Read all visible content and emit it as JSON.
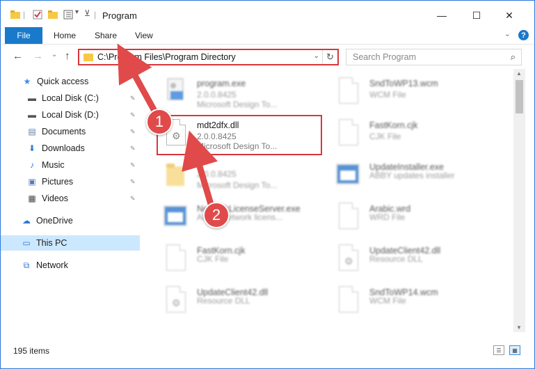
{
  "window": {
    "title": "Program",
    "minimize_glyph": "—",
    "maximize_glyph": "☐",
    "close_glyph": "✕"
  },
  "ribbon": {
    "tabs": [
      {
        "label": "File",
        "active": true
      },
      {
        "label": "Home"
      },
      {
        "label": "Share"
      },
      {
        "label": "View"
      }
    ],
    "help_glyph": "?",
    "expand_glyph": "⌄"
  },
  "nav": {
    "back_glyph": "←",
    "forward_glyph": "→",
    "recent_glyph": "⌄",
    "up_glyph": "↑"
  },
  "address": {
    "path": "C:\\Program Files\\Program Directory",
    "dropdown_glyph": "⌄",
    "refresh_glyph": "↻"
  },
  "search": {
    "placeholder": "Search Program",
    "icon_glyph": "⌕"
  },
  "sidebar": {
    "items": [
      {
        "label": "Quick access",
        "icon": "star-icon",
        "glyph": "★",
        "color": "#3c8de0",
        "pinned": false
      },
      {
        "label": "Local Disk (C:)",
        "icon": "drive-icon",
        "glyph": "▬",
        "color": "#555555",
        "pinned": true
      },
      {
        "label": "Local Disk (D:)",
        "icon": "drive-icon",
        "glyph": "▬",
        "color": "#555555",
        "pinned": true
      },
      {
        "label": "Documents",
        "icon": "documents-icon",
        "glyph": "▤",
        "color": "#5a7fb0",
        "pinned": true
      },
      {
        "label": "Downloads",
        "icon": "downloads-icon",
        "glyph": "⬇",
        "color": "#2b79d8",
        "pinned": true
      },
      {
        "label": "Music",
        "icon": "music-icon",
        "glyph": "♪",
        "color": "#2b79d8",
        "pinned": true
      },
      {
        "label": "Pictures",
        "icon": "pictures-icon",
        "glyph": "▣",
        "color": "#5a7fb0",
        "pinned": true
      },
      {
        "label": "Videos",
        "icon": "videos-icon",
        "glyph": "▦",
        "color": "#444444",
        "pinned": true
      },
      {
        "label": "OneDrive",
        "icon": "cloud-icon",
        "glyph": "☁",
        "color": "#2b79d8",
        "pinned": false
      },
      {
        "label": "This PC",
        "icon": "computer-icon",
        "glyph": "▭",
        "color": "#2b79d8",
        "pinned": false,
        "selected": true
      },
      {
        "label": "Network",
        "icon": "network-icon",
        "glyph": "⧉",
        "color": "#2b79d8",
        "pinned": false
      }
    ],
    "pin_glyph": "✎"
  },
  "files": [
    {
      "name": "program.exe",
      "line2": "2.0.0.8425",
      "line3": "Microsoft Design To...",
      "kind": "exe",
      "blur": true
    },
    {
      "name": "SndToWP13.wcm",
      "line2": "WCM File",
      "line3": "",
      "kind": "doc",
      "blur": true
    },
    {
      "name": "mdt2dfx.dll",
      "line2": "2.0.0.8425",
      "line3": "Microsoft Design To...",
      "kind": "dll",
      "blur": false,
      "highlighted": true
    },
    {
      "name": "FastKorn.cjk",
      "line2": "CJK File",
      "line3": "",
      "kind": "doc",
      "blur": true
    },
    {
      "name": "",
      "line2": "2.0.0.8425",
      "line3": "Microsoft Design To...",
      "kind": "folder",
      "blur": true
    },
    {
      "name": "UpdateInstaller.exe",
      "line2": "ABBY updates installer",
      "line3": "",
      "kind": "exe",
      "blur": true
    },
    {
      "name": "NetworkLicenseServer.exe",
      "line2": "ABBY Network licens...",
      "line3": "",
      "kind": "exe",
      "blur": true
    },
    {
      "name": "Arabic.wrd",
      "line2": "WRD File",
      "line3": "",
      "kind": "doc",
      "blur": true
    },
    {
      "name": "FastKorn.cjk",
      "line2": "CJK File",
      "line3": "",
      "kind": "doc",
      "blur": true
    },
    {
      "name": "UpdateClient42.dll",
      "line2": "Resource DLL",
      "line3": "",
      "kind": "dll",
      "blur": true
    },
    {
      "name": "UpdateClient42.dll",
      "line2": "Resource DLL",
      "line3": "",
      "kind": "dll",
      "blur": true
    },
    {
      "name": "SndToWP14.wcm",
      "line2": "WCM File",
      "line3": "",
      "kind": "doc",
      "blur": true
    }
  ],
  "status": {
    "item_count": "195 items"
  },
  "annotations": {
    "step1": "1",
    "step2": "2",
    "color": "#e04a4a"
  }
}
